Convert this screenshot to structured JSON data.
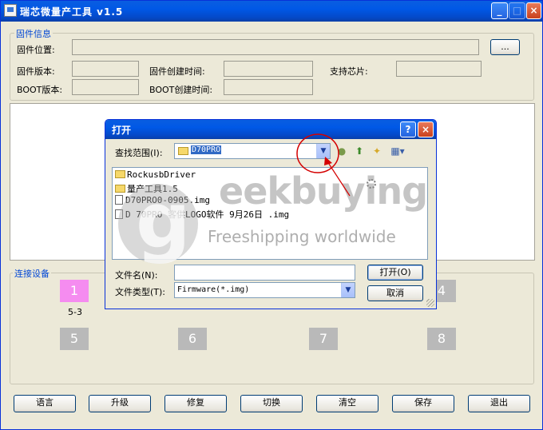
{
  "window": {
    "title": "瑞芯微量产工具 v1.5",
    "controls": [
      "minimize",
      "maximize",
      "close"
    ]
  },
  "firmware_info": {
    "group_label": "固件信息",
    "location_label": "固件位置:",
    "location_value": "",
    "browse_label": "...",
    "version_label": "固件版本:",
    "version_value": "",
    "created_label": "固件创建时间:",
    "created_value": "",
    "chip_label": "支持芯片:",
    "chip_value": "",
    "boot_version_label": "BOOT版本:",
    "boot_version_value": "",
    "boot_created_label": "BOOT创建时间:",
    "boot_created_value": ""
  },
  "devices": {
    "group_label": "连接设备",
    "slots": [
      {
        "label": "1",
        "status": "active",
        "sub": "5-3"
      },
      {
        "label": "4"
      },
      {
        "label": "5"
      },
      {
        "label": "6"
      },
      {
        "label": "7"
      },
      {
        "label": "8"
      }
    ]
  },
  "open_dialog": {
    "title": "打开",
    "look_in_label": "查找范围(I):",
    "look_in_value": "D70PRO",
    "files": [
      {
        "name": "RockusbDriver",
        "type": "folder"
      },
      {
        "name": "量产工具1.5",
        "type": "folder"
      },
      {
        "name": "D70PRO0-0905.img",
        "type": "file"
      },
      {
        "name": "D 70PRO  客供LOGO软件 9月26日 .img",
        "type": "file"
      }
    ],
    "filename_label": "文件名(N):",
    "filename_value": "",
    "filetype_label": "文件类型(T):",
    "filetype_value": "Firmware(*.img)",
    "open_button": "打开(O)",
    "cancel_button": "取消"
  },
  "watermark": {
    "brand": "eekbuying",
    "tagline": "Freeshipping worldwide"
  },
  "bottom_buttons": [
    "语言",
    "升级",
    "修复",
    "切换",
    "清空",
    "保存",
    "退出"
  ],
  "colors": {
    "titlebar": "#0058e6",
    "group_label": "#0046d5",
    "device_active": "#f58cf0",
    "device_idle": "#b9b9b9",
    "annotation": "#d40000"
  }
}
